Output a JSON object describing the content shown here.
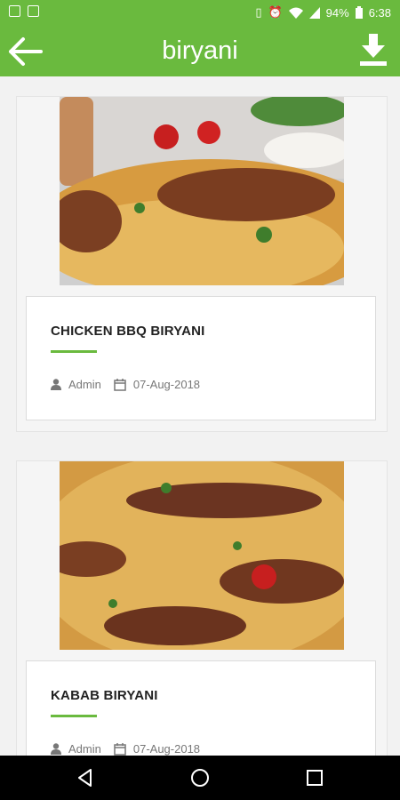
{
  "status_bar": {
    "battery": "94%",
    "time": "6:38",
    "icons": [
      "message-icon",
      "image-icon",
      "vibrate-icon",
      "alarm-icon",
      "wifi-icon",
      "signal-icon",
      "battery-icon"
    ]
  },
  "app_bar": {
    "title": "biryani",
    "back_icon": "arrow-left-icon",
    "download_icon": "download-icon"
  },
  "posts": [
    {
      "title": "CHICKEN BBQ BIRYANI",
      "author": "Admin",
      "date": "07-Aug-2018"
    },
    {
      "title": "KABAB BIRYANI",
      "author": "Admin",
      "date": "07-Aug-2018"
    }
  ],
  "nav_bar": {
    "buttons": [
      "back-triangle-icon",
      "home-circle-icon",
      "recents-square-icon"
    ]
  },
  "colors": {
    "accent": "#6aba3e",
    "rule": "#6aba3e"
  }
}
